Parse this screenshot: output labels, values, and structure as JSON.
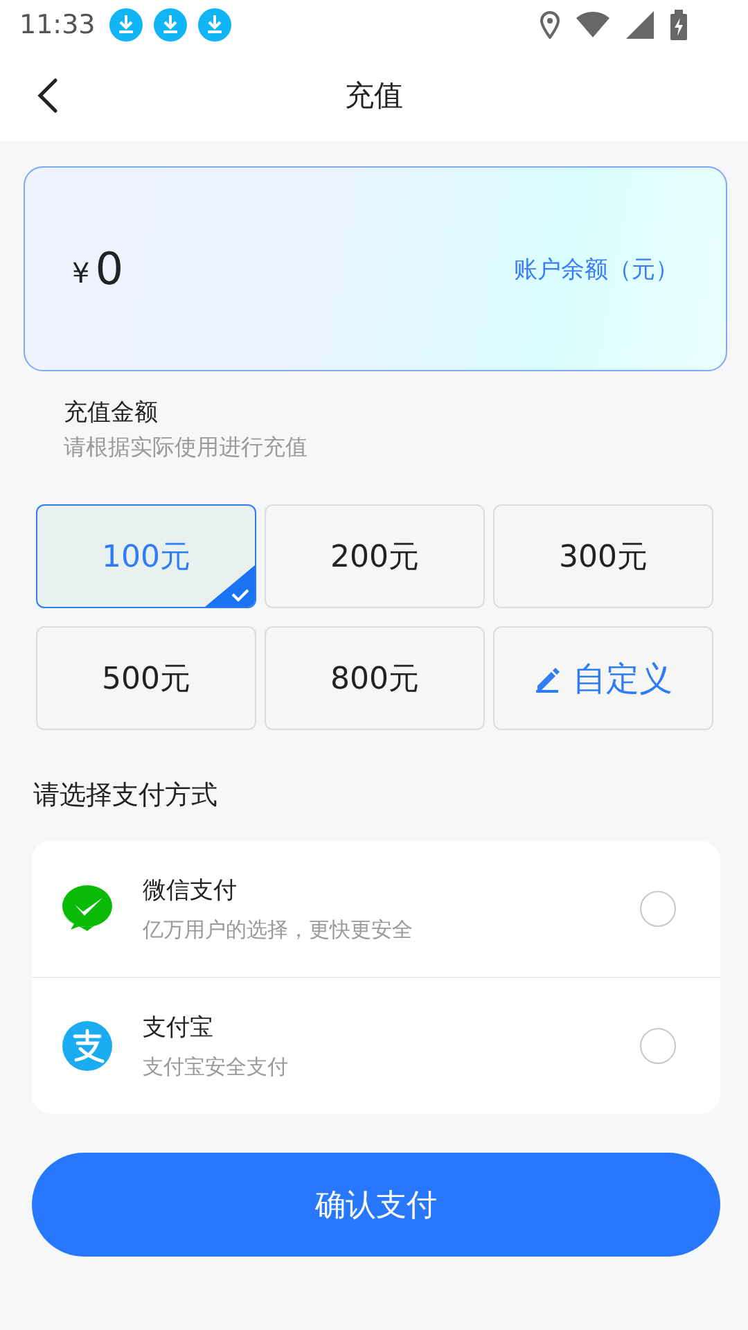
{
  "status_bar": {
    "time": "11:33",
    "notifications": [
      {
        "kind": "download"
      },
      {
        "kind": "download"
      },
      {
        "kind": "download"
      }
    ]
  },
  "header": {
    "title": "充值"
  },
  "balance": {
    "currency": "¥",
    "amount": "0",
    "label": "账户余额（元）"
  },
  "recharge": {
    "title": "充值金额",
    "hint": "请根据实际使用进行充值",
    "options": [
      {
        "kind": "amount",
        "label": "100元",
        "selected": true
      },
      {
        "kind": "amount",
        "label": "200元",
        "selected": false
      },
      {
        "kind": "amount",
        "label": "300元",
        "selected": false
      },
      {
        "kind": "amount",
        "label": "500元",
        "selected": false
      },
      {
        "kind": "amount",
        "label": "800元",
        "selected": false
      },
      {
        "kind": "custom",
        "label": "自定义",
        "selected": false
      }
    ]
  },
  "payment": {
    "title": "请选择支付方式",
    "methods": [
      {
        "kind": "wechat",
        "name": "微信支付",
        "desc": "亿万用户的选择，更快更安全",
        "selected": false
      },
      {
        "kind": "alipay",
        "name": "支付宝",
        "desc": "支付宝安全支付",
        "selected": false
      }
    ]
  },
  "confirm": {
    "label": "确认支付"
  }
}
